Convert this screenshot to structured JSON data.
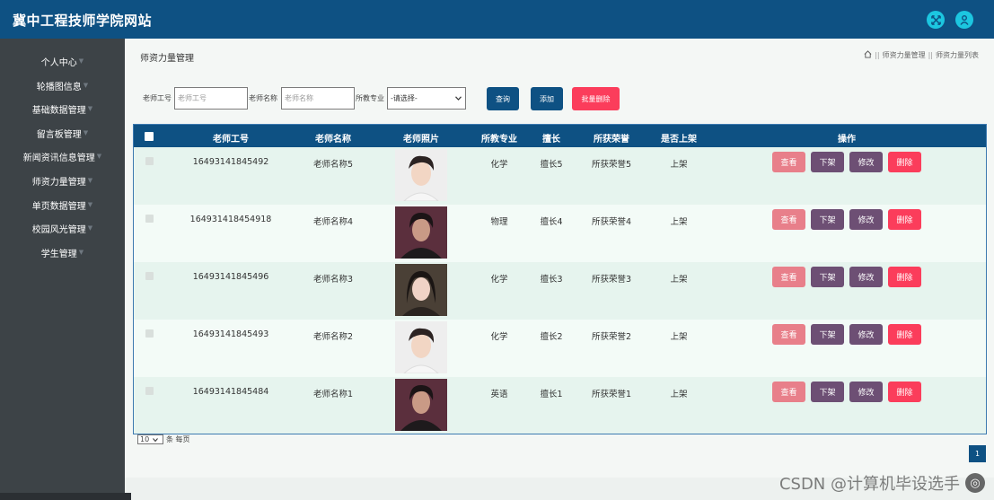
{
  "header": {
    "site_title": "冀中工程技师学院网站",
    "icons": [
      "fullscreen-icon",
      "user-icon"
    ]
  },
  "sidebar": {
    "items": [
      {
        "label": "个人中心"
      },
      {
        "label": "轮播图信息"
      },
      {
        "label": "基础数据管理"
      },
      {
        "label": "留言板管理"
      },
      {
        "label": "新闻资讯信息管理"
      },
      {
        "label": "师资力量管理"
      },
      {
        "label": "单页数据管理"
      },
      {
        "label": "校园风光管理"
      },
      {
        "label": "学生管理"
      }
    ]
  },
  "main": {
    "title": "师资力量管理",
    "breadcrumb": [
      "师资力量管理",
      "师资力量列表"
    ]
  },
  "search": {
    "teacher_no_label": "老师工号",
    "teacher_no_placeholder": "老师工号",
    "teacher_name_label": "老师名称",
    "teacher_name_placeholder": "老师名称",
    "major_label": "所教专业",
    "major_selected": "-请选择-",
    "query_button": "查询",
    "add_button": "添加",
    "batch_delete_button": "批量删除"
  },
  "table": {
    "columns": [
      "老师工号",
      "老师名称",
      "老师照片",
      "所教专业",
      "擅长",
      "所获荣誉",
      "是否上架",
      "操作"
    ],
    "rows": [
      {
        "id": "16493141845492",
        "name": "老师名称5",
        "photo": "young man, light shirt",
        "major": "化学",
        "skill": "擅长5",
        "honor": "所获荣誉5",
        "status": "上架"
      },
      {
        "id": "164931418454918",
        "name": "老师名称4",
        "photo": "man, dark scarf",
        "major": "物理",
        "skill": "擅长4",
        "honor": "所获荣誉4",
        "status": "上架"
      },
      {
        "id": "16493141845496",
        "name": "老师名称3",
        "photo": "woman, dark hair",
        "major": "化学",
        "skill": "擅长3",
        "honor": "所获荣誉3",
        "status": "上架"
      },
      {
        "id": "16493141845493",
        "name": "老师名称2",
        "photo": "young man, light shirt",
        "major": "化学",
        "skill": "擅长2",
        "honor": "所获荣誉2",
        "status": "上架"
      },
      {
        "id": "16493141845484",
        "name": "老师名称1",
        "photo": "man, dark scarf",
        "major": "英语",
        "skill": "擅长1",
        "honor": "所获荣誉1",
        "status": "上架"
      }
    ],
    "actions": {
      "view": "查看",
      "offline": "下架",
      "edit": "修改",
      "delete": "删除"
    }
  },
  "pager": {
    "page_size": "10",
    "per_page_suffix": "条 每页",
    "current_page": "1"
  },
  "colors": {
    "header_bg": "#0e5183",
    "sidebar_bg": "#3d4347",
    "btn_view": "#e87f8a",
    "btn_offline": "#6d4f74",
    "btn_edit": "#6d4f74",
    "btn_delete": "#fb3d5b",
    "btn_batch_delete": "#fb3d5b",
    "row_bg": "#e6f4ee"
  },
  "watermark": "CSDN @计算机毕设选手"
}
